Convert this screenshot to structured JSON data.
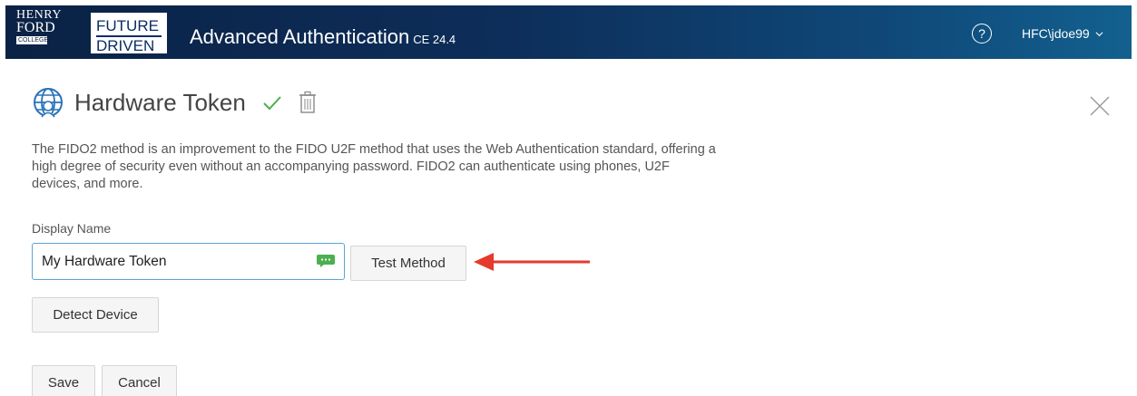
{
  "header": {
    "logo_left": {
      "line1": "HENRY",
      "line2": "FORD",
      "line3": "COLLEGE"
    },
    "logo_right": {
      "line1": "FUTURE",
      "line2": "DRIVEN"
    },
    "app_title": "Advanced Authentication",
    "app_version": "CE 24.4",
    "help_icon": "help-icon",
    "user_name": "HFC\\jdoe99",
    "colors": {
      "header_start": "#0a2245",
      "header_end": "#13608f"
    }
  },
  "page": {
    "title": "Hardware Token",
    "title_icon": "globe-user-icon",
    "status_icon": "check-icon",
    "status_color": "#4caf50",
    "delete_icon": "trash-icon",
    "close_icon": "close-icon",
    "description": "The FIDO2 method is an improvement to the FIDO U2F method that uses the Web Authentication standard, offering a high degree of security even without an accompanying password. FIDO2 can authenticate using phones, U2F devices, and more."
  },
  "form": {
    "display_name_label": "Display Name",
    "display_name_value": "My Hardware Token",
    "test_method_label": "Test Method",
    "detect_device_label": "Detect Device",
    "save_label": "Save",
    "cancel_label": "Cancel"
  },
  "annotation": {
    "arrow_color": "#e53a2e"
  }
}
